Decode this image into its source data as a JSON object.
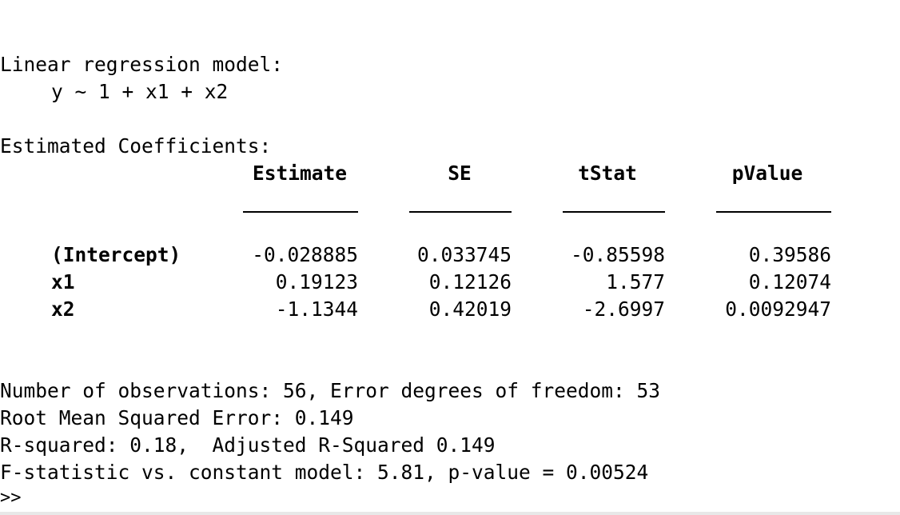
{
  "model_header": "Linear regression model:",
  "formula": "y ~ 1 + x1 + x2",
  "coef_header": "Estimated Coefficients:",
  "columns": [
    "Estimate",
    "SE",
    "tStat",
    "pValue"
  ],
  "rows": [
    {
      "name": "(Intercept)",
      "values": [
        "-0.028885",
        "0.033745",
        "-0.85598",
        "0.39586"
      ]
    },
    {
      "name": "x1",
      "values": [
        "0.19123",
        "0.12126",
        "1.577",
        "0.12074"
      ]
    },
    {
      "name": "x2",
      "values": [
        "-1.1344",
        "0.42019",
        "-2.6997",
        "0.0092947"
      ]
    }
  ],
  "summary": [
    "Number of observations: 56, Error degrees of freedom: 53",
    "Root Mean Squared Error: 0.149",
    "R-squared: 0.18,  Adjusted R-Squared 0.149",
    "F-statistic vs. constant model: 5.81, p-value = 0.00524"
  ],
  "prompt": ">>"
}
